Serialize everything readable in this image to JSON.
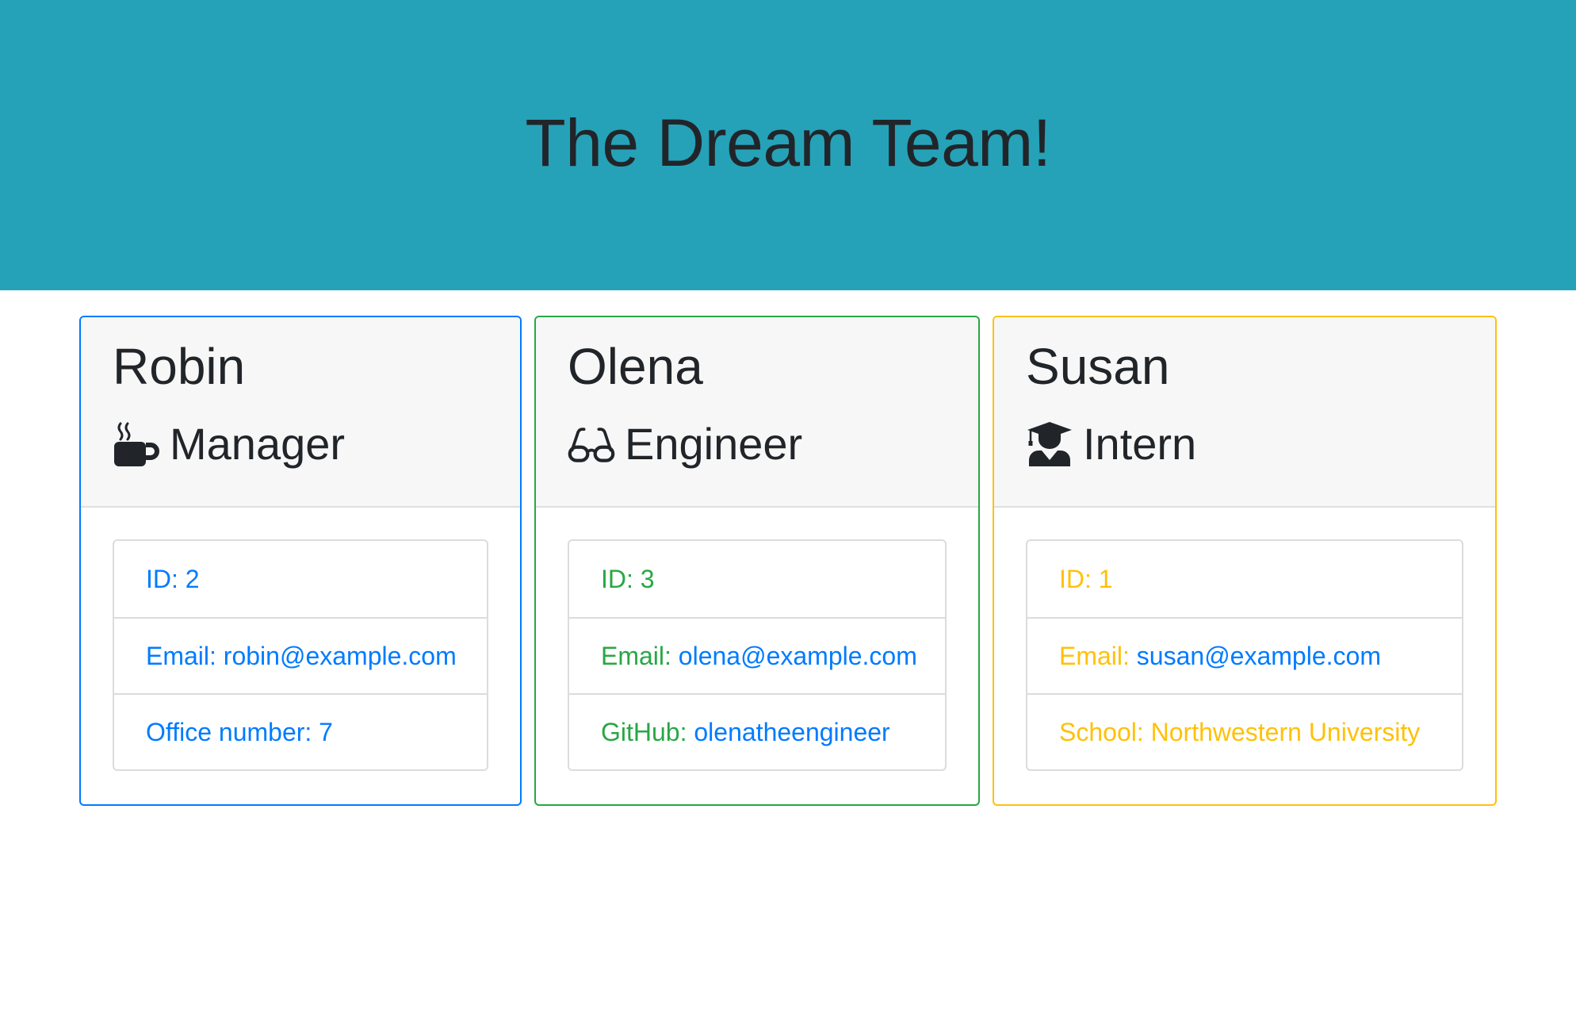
{
  "page": {
    "title": "The Dream Team!"
  },
  "colors": {
    "header_bg": "#25a2b8",
    "manager": "#007bff",
    "engineer": "#28a745",
    "intern": "#ffc107",
    "link": "#007bff"
  },
  "cards": [
    {
      "name": "Robin",
      "role": "Manager",
      "icon": "mug-hot-icon",
      "id_label": "ID: 2",
      "email_label": "Email: ",
      "email": "robin@example.com",
      "extra_label": "Office number: 7",
      "extra_value": ""
    },
    {
      "name": "Olena",
      "role": "Engineer",
      "icon": "glasses-icon",
      "id_label": "ID: 3",
      "email_label": "Email: ",
      "email": "olena@example.com",
      "extra_label": "GitHub: ",
      "extra_value": "olenatheengineer"
    },
    {
      "name": "Susan",
      "role": "Intern",
      "icon": "user-graduate-icon",
      "id_label": "ID: 1",
      "email_label": "Email: ",
      "email": "susan@example.com",
      "extra_label": "School: Northwestern University",
      "extra_value": ""
    }
  ]
}
